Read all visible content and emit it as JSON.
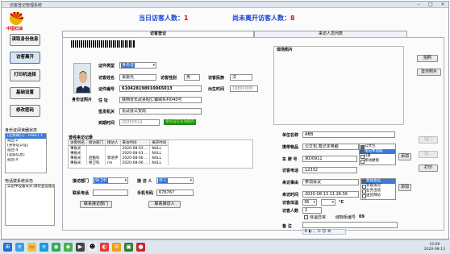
{
  "window": {
    "title": "访客登记管理系统"
  },
  "brand": {
    "name": "中国石油"
  },
  "banner": {
    "today_label": "当日访客人数：",
    "today_count": "1",
    "pending_label": "尚未离开访客人数：",
    "pending_count": "8"
  },
  "sidebar": {
    "buttons": [
      "读取身份信息",
      "访客离开",
      "打印机选择",
      "基础设置",
      "修改密码"
    ],
    "id_reader_title": "身份证阅读器状态",
    "id_reader_lines": [
      "[连接端口] : USB口 1",
      "返回 2",
      "[身份证认证]",
      "返回 4",
      "[读取信息]",
      "返回 4"
    ],
    "phone_title": "电话拨系统状态",
    "phone_lines": [
      "实验中设备未开,请检查设备是否"
    ]
  },
  "tabs": [
    "访客登记",
    "来访人员列表"
  ],
  "barcode_text": "",
  "form": {
    "cert_type_label": "证件类型",
    "cert_type_value": "身份证",
    "visitor_name_label": "访客姓名",
    "visitor_name": "事振光",
    "gender_label": "访客性别",
    "gender": "男",
    "ethnicity_label": "访客民族",
    "ethnicity": "汉",
    "cert_no_label": "证件编号",
    "cert_no": "610428198910065013",
    "birth_label": "出生时间",
    "birth": "19891006",
    "address_label": "住    址",
    "address": "陕西省长武县昭仁镇城东村040号",
    "photo_label": "身份证照片",
    "issuer_label": "签发机关",
    "issuer": "长武县公安局",
    "expiry_label": "到期时间",
    "expiry": "20250514",
    "expiry_status": "身份证在有效期内"
  },
  "history": {
    "title": "曾经来访记录",
    "columns": [
      "访客姓名",
      "接访部门",
      "接访人",
      "来访时间",
      "离开时间"
    ],
    "rows": [
      [
        "事振光",
        "",
        "",
        "2020-08-03 ...",
        "NULL"
      ],
      [
        "事振光",
        "",
        "",
        "2020-08-03 ...",
        "NULL"
      ],
      [
        "事振光",
        "后勤科",
        "郭浩宇",
        "2020-08-06 ...",
        "NULL"
      ],
      [
        "事振光",
        "保卫科",
        "rre",
        "2020-08-06 ...",
        "NULL"
      ]
    ]
  },
  "reception": {
    "dept_label": "接访部门",
    "dept": "保卫科",
    "person_label": "接 访 人",
    "person": "张三",
    "phone_label": "联系电话",
    "phone": "",
    "mobile_label": "手机号码",
    "mobile": "676767",
    "contact_dept_btn": "联系接访部门",
    "contact_person_btn": "联系接访人"
  },
  "scene": {
    "title": "现场照片",
    "capture_btn": "拍照",
    "show_btn": "显示照片",
    "print_btn": "打印",
    "btn_d1": "拍门",
    "btn_d2": "拍...",
    "unit_label": "单位名称",
    "unit": "ABB",
    "items_label": "携带物品",
    "items": "公文包,笔记本电脑",
    "items_options": [
      {
        "label": "公文包",
        "checked": true,
        "selected": false
      },
      {
        "label": "笔记本电脑",
        "checked": true,
        "selected": true
      },
      {
        "label": "U盘",
        "checked": false,
        "selected": false
      },
      {
        "label": "移动硬盘",
        "checked": false,
        "selected": false
      }
    ],
    "add1": "添加",
    "plate_label": "车 牌 号",
    "plate": "京D0911",
    "phone_label": "访客电话",
    "phone": "12332",
    "reason_label": "来访事由",
    "reason": "参加会议",
    "reason_options": [
      {
        "label": "参加会议",
        "checked": true,
        "selected": true
      },
      {
        "label": "参观访问",
        "checked": false,
        "selected": false
      },
      {
        "label": "业务洽谈",
        "checked": false,
        "selected": false
      },
      {
        "label": "送货拜访",
        "checked": false,
        "selected": false
      }
    ],
    "add2": "添加",
    "time_label": "来访时间",
    "time": "2020-08-13 11:26:56",
    "temp_label": "访客体温",
    "temp_value": "36",
    "temp_unit": "°C",
    "count_label": "访客人数",
    "count": "2",
    "abnormal_label": "体温异常",
    "locker_label": "储物柜编号",
    "locker": "09",
    "remark_label": "备    注"
  },
  "taskbar": {
    "time": "12:00",
    "date": "2020-08-13"
  }
}
